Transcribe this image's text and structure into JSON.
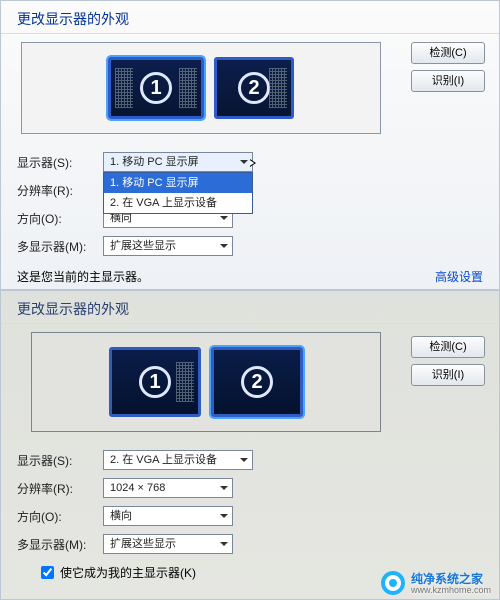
{
  "top": {
    "title": "更改显示器的外观",
    "buttons": {
      "detect": "检测(C)",
      "identify": "识别(I)"
    },
    "monitors": [
      "1",
      "2"
    ],
    "form": {
      "display_label": "显示器(S):",
      "display_value": "1. 移动 PC 显示屏",
      "display_options": [
        "1. 移动 PC 显示屏",
        "2. 在 VGA 上显示设备"
      ],
      "resolution_label": "分辨率(R):",
      "orientation_label": "方向(O):",
      "orientation_value": "横向",
      "multi_label": "多显示器(M):",
      "multi_value": "扩展这些显示"
    },
    "note": "这是您当前的主显示器。",
    "advanced": "高级设置"
  },
  "bottom": {
    "title": "更改显示器的外观",
    "buttons": {
      "detect": "检测(C)",
      "identify": "识别(I)"
    },
    "monitors": [
      "1",
      "2"
    ],
    "form": {
      "display_label": "显示器(S):",
      "display_value": "2. 在 VGA 上显示设备",
      "resolution_label": "分辨率(R):",
      "resolution_value": "1024 × 768",
      "orientation_label": "方向(O):",
      "orientation_value": "横向",
      "multi_label": "多显示器(M):",
      "multi_value": "扩展这些显示"
    },
    "checkbox_label": "使它成为我的主显示器(K)",
    "checkbox_checked": true
  },
  "watermark": {
    "zh": "纯净系统之家",
    "en": "www.kzmhome.com"
  }
}
